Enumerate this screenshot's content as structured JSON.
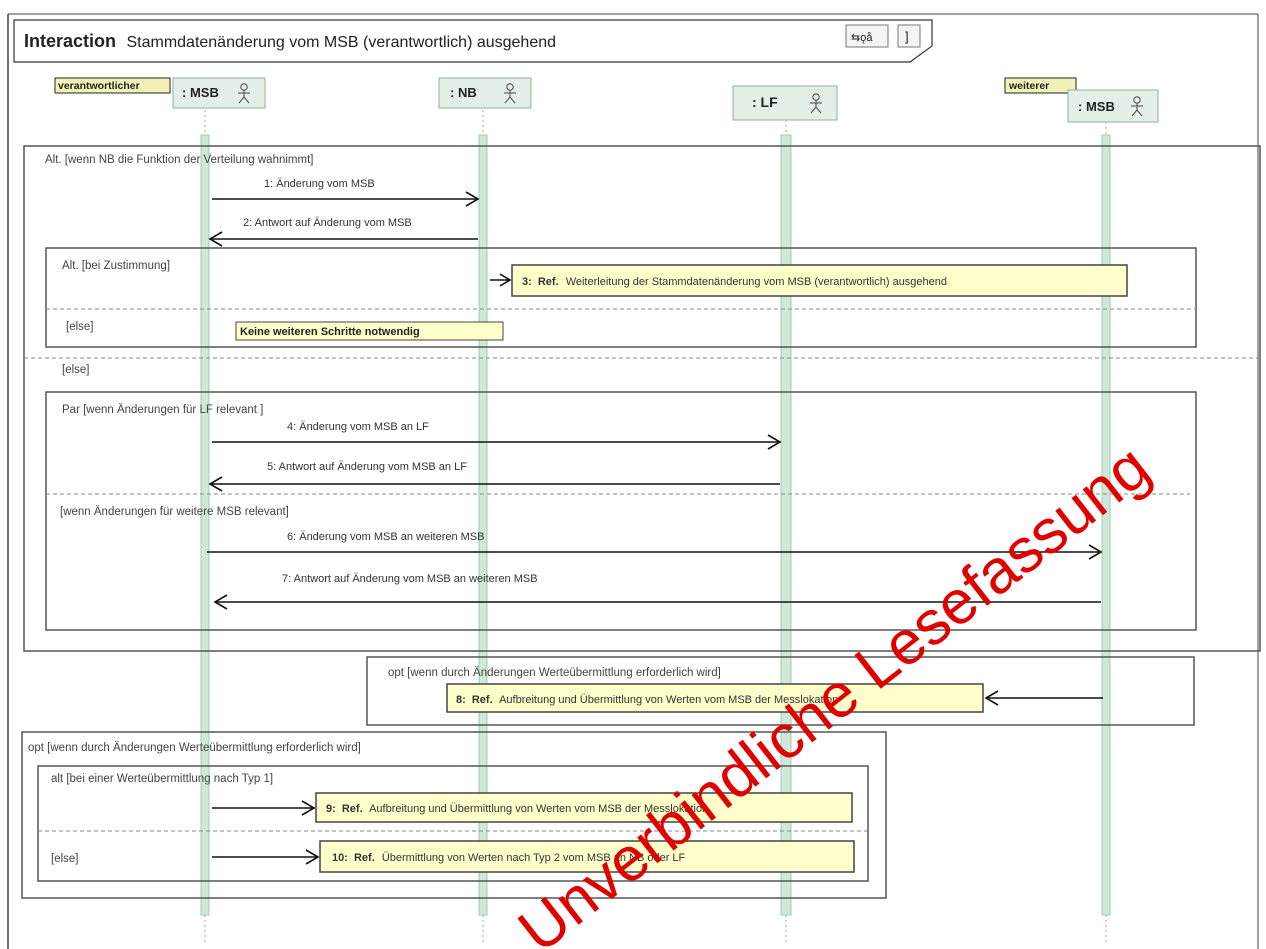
{
  "frame": {
    "keyword": "Interaction",
    "name": "Stammdatenänderung vom MSB (verantwortlich) ausgehend",
    "icon": "interaction-icon"
  },
  "participants": [
    {
      "id": "msb_v",
      "name": ": MSB",
      "tag": "verantwortlicher",
      "icon": "actor-icon"
    },
    {
      "id": "nb",
      "name": ": NB",
      "tag": "",
      "icon": "actor-icon"
    },
    {
      "id": "lf",
      "name": ": LF",
      "tag": "",
      "icon": "actor-icon"
    },
    {
      "id": "msb_w",
      "name": ": MSB",
      "tag": "weiterer",
      "icon": "actor-icon"
    }
  ],
  "fragments": {
    "alt_main": {
      "guard": "Alt. [wenn NB die Funktion der Verteilung wahnimmt]",
      "else": "[else]"
    },
    "alt_inner": {
      "guard": "Alt. [bei Zustimmung]",
      "else": "[else]"
    },
    "par": {
      "guard": "Par [wenn Änderungen für LF relevant ]",
      "guard2": "[wenn Änderungen für weitere MSB relevant]"
    },
    "opt1": {
      "guard": "opt [wenn durch Änderungen Werteübermittlung erforderlich wird]"
    },
    "opt2": {
      "guard": "opt [wenn durch Änderungen Werteübermittlung erforderlich wird]"
    },
    "alt_typ": {
      "guard": "alt [bei einer Werteübermittlung nach Typ 1]",
      "else": "[else]"
    }
  },
  "messages": [
    {
      "n": "1",
      "label": "1: Änderung vom MSB",
      "from": "msb_v",
      "to": "nb"
    },
    {
      "n": "2",
      "label": "2: Antwort auf Änderung vom MSB",
      "from": "nb",
      "to": "msb_v"
    },
    {
      "n": "4",
      "label": "4: Änderung vom MSB an LF",
      "from": "msb_v",
      "to": "lf"
    },
    {
      "n": "5",
      "label": "5: Antwort auf Änderung vom MSB an LF",
      "from": "lf",
      "to": "msb_v"
    },
    {
      "n": "6",
      "label": "6: Änderung vom MSB an weiteren MSB",
      "from": "msb_v",
      "to": "msb_w"
    },
    {
      "n": "7",
      "label": "7: Antwort auf Änderung vom MSB an weiteren MSB",
      "from": "msb_w",
      "to": "msb_v"
    }
  ],
  "refs": [
    {
      "num": "3:",
      "kw": "Ref.",
      "text": "Weiterleitung der Stammdatenänderung vom MSB (verantwortlich) ausgehend"
    },
    {
      "num": "8:",
      "kw": "Ref.",
      "text": "Aufbreitung und Übermittlung von Werten vom MSB der Messlokation"
    },
    {
      "num": "9:",
      "kw": "Ref.",
      "text": "Aufbreitung und Übermittlung von Werten vom MSB der Messlokation"
    },
    {
      "num": "10:",
      "kw": "Ref.",
      "text": "Übermittlung von Werten nach Typ 2 vom MSB an NB oder LF"
    }
  ],
  "note": "Keine weiteren Schritte notwendig",
  "watermark": "Unverbindliche Lesefassung"
}
